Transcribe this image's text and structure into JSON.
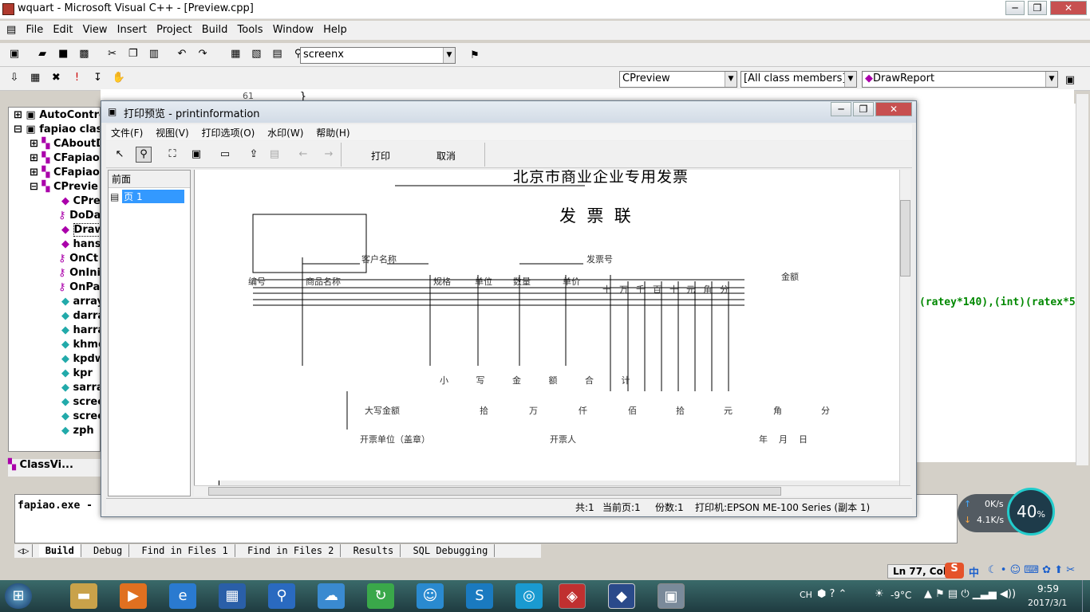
{
  "window": {
    "title": "wquart - Microsoft Visual C++ - [Preview.cpp]",
    "min": "─",
    "max": "❐",
    "close": "✕"
  },
  "menu": [
    "File",
    "Edit",
    "View",
    "Insert",
    "Project",
    "Build",
    "Tools",
    "Window",
    "Help"
  ],
  "toolbar": {
    "find_combo": "screenx"
  },
  "wizardbar": {
    "class": "CPreview",
    "filter": "[All class members]",
    "member": "DrawReport"
  },
  "tree": {
    "items": [
      "AutoContro",
      "fapiao clas",
      "CAboutD",
      "CFapiao",
      "CFapiao",
      "CPrevie",
      "CPre",
      "DoDa",
      "Draw",
      "hans",
      "OnCt",
      "OnIni",
      "OnPa",
      "array",
      "darra",
      "harra",
      "khmo",
      "kpdw",
      "kpr",
      "sarra",
      "scree",
      "scree",
      "zph"
    ]
  },
  "tree_tabs": {
    "classview": "ClassVi..."
  },
  "code": {
    "line_no": "61",
    "line_text": "}",
    "frag": "(ratey*140),(int)(ratex*5"
  },
  "dialog": {
    "title": "打印预览 - printinformation",
    "menu": [
      "文件(F)",
      "视图(V)",
      "打印选项(O)",
      "水印(W)",
      "帮助(H)"
    ],
    "print_btn": "打印",
    "cancel_btn": "取消",
    "left_pane_header": "前面",
    "page_item": "页 1",
    "status": {
      "total": "共:1",
      "current": "当前页:1",
      "copies": "份数:1",
      "printer": "打印机:EPSON ME-100 Series (副本 1)"
    }
  },
  "invoice": {
    "heading": "北京市商业企业专用发票",
    "sub": "发  票  联",
    "customer": "客户名称",
    "invoice_no": "发票号",
    "col_no": "编号",
    "col_name": "商品名称",
    "col_spec": "规格",
    "col_unit": "单位",
    "col_qty": "数量",
    "col_price": "单价",
    "amount_label": "金额",
    "amount_digits": [
      "十",
      "万",
      "千",
      "百",
      "十",
      "元",
      "角",
      "分"
    ],
    "subtotal": "小   写   金   额   合   计",
    "capital": "大写金额",
    "capital_units": [
      "拾",
      "万",
      "仟",
      "佰",
      "拾",
      "元",
      "角",
      "分"
    ],
    "seller": "开票单位（盖章）",
    "issuer": "开票人",
    "date": "年    月    日"
  },
  "output": {
    "text": "fapiao.exe -",
    "tabs": [
      "Build",
      "Debug",
      "Find in Files 1",
      "Find in Files 2",
      "Results",
      "SQL Debugging"
    ]
  },
  "status_bar": {
    "ln": "Ln 77, Col"
  },
  "net": {
    "up": "0K/s",
    "down": "4.1K/s",
    "cpu": "40",
    "pct": "%"
  },
  "tray": {
    "ime": "中",
    "lang": "CH",
    "temp": "-9°C",
    "time": "9:59",
    "date": "2017/3/1"
  }
}
